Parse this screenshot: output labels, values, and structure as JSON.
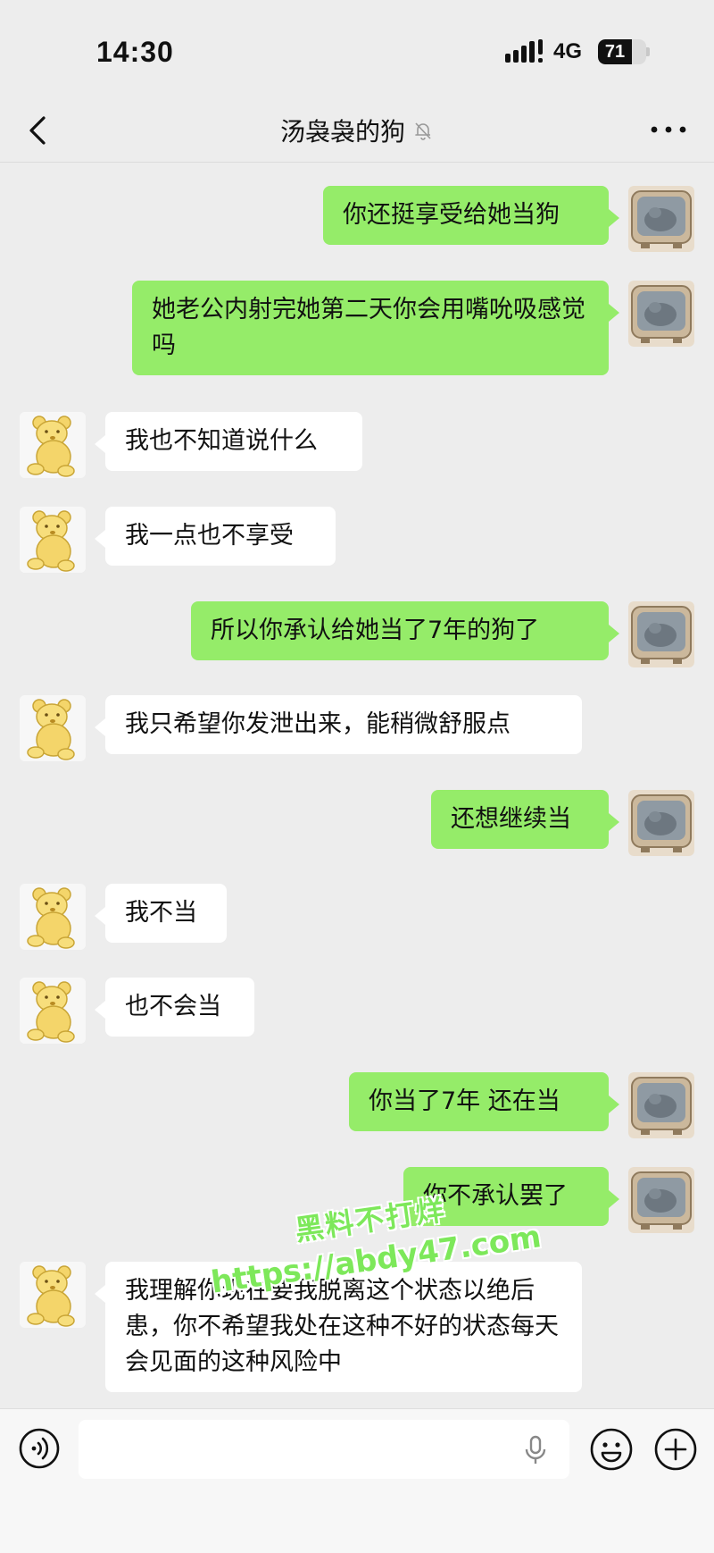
{
  "status_bar": {
    "time": "14:30",
    "network": "4G",
    "battery_level": "71",
    "battery_fraction": 0.71
  },
  "header": {
    "title": "汤袅袅的狗",
    "back_icon": "chevron-left-icon",
    "mute_icon": "muted-bell-icon",
    "more_icon": "more-dots-icon"
  },
  "messages": [
    {
      "side": "right",
      "text": "你还挺享受给她当狗"
    },
    {
      "side": "right",
      "text": "她老公内射完她第二天你会用嘴吮吸感觉吗"
    },
    {
      "side": "left",
      "text": "我也不知道说什么"
    },
    {
      "side": "left",
      "text": "我一点也不享受"
    },
    {
      "side": "right",
      "text": "所以你承认给她当了7年的狗了"
    },
    {
      "side": "left",
      "text": "我只希望你发泄出来，能稍微舒服点"
    },
    {
      "side": "right",
      "text": "还想继续当"
    },
    {
      "side": "left",
      "text": "我不当"
    },
    {
      "side": "left",
      "text": "也不会当"
    },
    {
      "side": "right",
      "text": "你当了7年 还在当"
    },
    {
      "side": "right",
      "text": "你不承认罢了"
    },
    {
      "side": "left",
      "text": "我理解你现在要我脱离这个状态以绝后患，你不希望我处在这种不好的状态每天会见面的这种风险中"
    }
  ],
  "watermark": {
    "line1": "黑料不打烊",
    "line2": "https://abdy47.com"
  },
  "input_bar": {
    "placeholder": "",
    "voice_icon": "voice-icon",
    "mic_icon": "mic-icon",
    "emoji_icon": "emoji-icon",
    "add_icon": "plus-circle-icon"
  },
  "colors": {
    "background": "#ededed",
    "sent_bubble": "#95ec69",
    "received_bubble": "#ffffff"
  }
}
